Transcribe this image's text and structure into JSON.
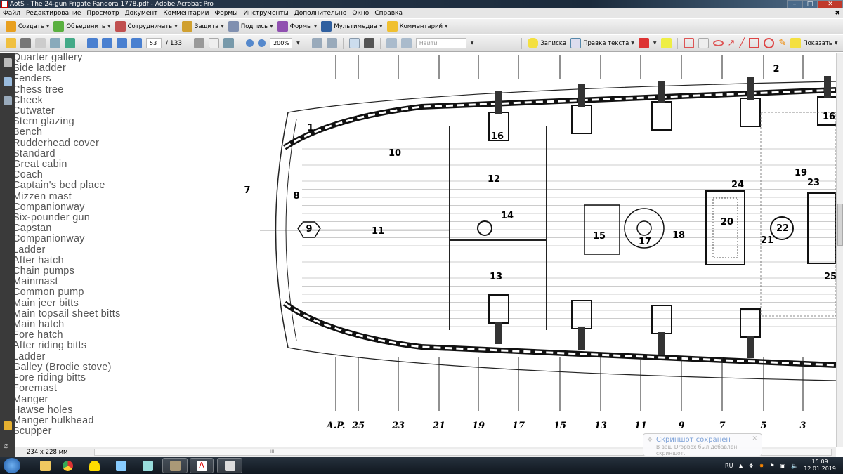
{
  "window": {
    "title": "AotS - The 24-gun Frigate Pandora 1778.pdf - Adobe Acrobat Pro",
    "minimize": "–",
    "maximize": "□",
    "close": "✕"
  },
  "menu": [
    "Файл",
    "Редактирование",
    "Просмотр",
    "Документ",
    "Комментарии",
    "Формы",
    "Инструменты",
    "Дополнительно",
    "Окно",
    "Справка"
  ],
  "menu_close": "✖",
  "toolbar1": [
    {
      "label": "Создать",
      "icon": "create-icon",
      "color": "#e8a020"
    },
    {
      "label": "Объединить",
      "icon": "combine-icon",
      "color": "#5ab040"
    },
    {
      "label": "Сотрудничать",
      "icon": "collaborate-icon",
      "color": "#c05050"
    },
    {
      "label": "Защита",
      "icon": "lock-icon",
      "color": "#d0a030"
    },
    {
      "label": "Подпись",
      "icon": "pen-icon",
      "color": "#8090b0"
    },
    {
      "label": "Формы",
      "icon": "forms-icon",
      "color": "#9050b0"
    },
    {
      "label": "Мультимедиа",
      "icon": "multimedia-icon",
      "color": "#3060a0"
    },
    {
      "label": "Комментарий",
      "icon": "comment-icon",
      "color": "#f0c030"
    }
  ],
  "toolbar2": {
    "page_current": "53",
    "page_total": "/ 133",
    "zoom": "200%",
    "search_placeholder": "Найти",
    "note": "Записка",
    "text_edit": "Правка текста",
    "show": "Показать"
  },
  "legend": [
    "Quarter gallery",
    "Side ladder",
    "Fenders",
    "Chess tree",
    "Cheek",
    "Cutwater",
    "Stern glazing",
    "Bench",
    "Rudderhead cover",
    "Standard",
    "Great cabin",
    "Coach",
    "Captain's bed place",
    "Mizzen mast",
    "Companionway",
    "Six-pounder gun",
    "Capstan",
    "Companionway",
    "Ladder",
    "After hatch",
    "Chain pumps",
    "Mainmast",
    "Common pump",
    "Main jeer bitts",
    "Main topsail sheet bitts",
    "Main hatch",
    "Fore hatch",
    "After riding bitts",
    "Ladder",
    "Galley (Brodie stove)",
    "Fore riding bitts",
    "Foremast",
    "Manger",
    "Hawse holes",
    "Manger bulkhead",
    "Scupper"
  ],
  "drawing": {
    "stations": [
      "A.P.",
      "25",
      "23",
      "21",
      "19",
      "17",
      "15",
      "13",
      "11",
      "9",
      "7",
      "5",
      "3"
    ],
    "callouts": [
      "1",
      "2",
      "7",
      "8",
      "9",
      "10",
      "11",
      "12",
      "13",
      "14",
      "15",
      "16",
      "16",
      "17",
      "18",
      "19",
      "20",
      "21",
      "22",
      "23",
      "24",
      "25"
    ]
  },
  "status": {
    "page_size": "234 x 228 мм",
    "scroll_grip": "III"
  },
  "toast": {
    "title": "Скриншот сохранен",
    "message": "В ваш Dropbox был добавлен скриншот."
  },
  "tray": {
    "lang": "RU",
    "time": "15:09",
    "date": "12.01.2019"
  },
  "taskbar": [
    "explorer",
    "chrome",
    "hardhat-app",
    "calculator",
    "notepad",
    "windows-app",
    "acrobat",
    "app"
  ]
}
